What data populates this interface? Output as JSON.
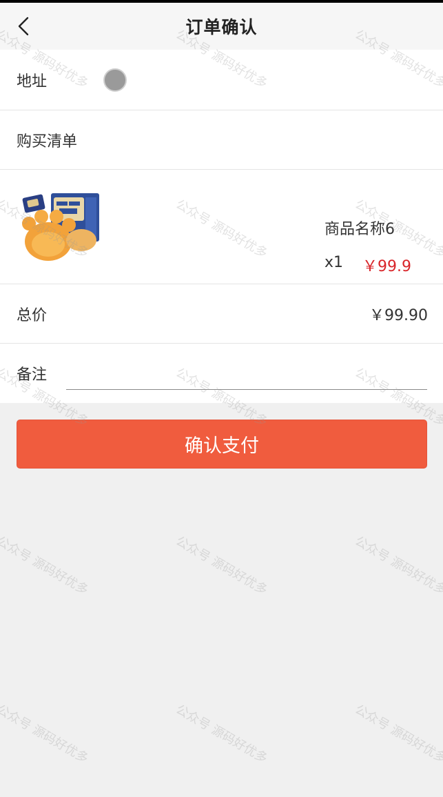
{
  "navbar": {
    "title": "订单确认",
    "back_icon": "chevron-left-icon"
  },
  "address": {
    "label": "地址"
  },
  "purchase_list": {
    "label": "购买清单"
  },
  "product": {
    "name": "商品名称6",
    "quantity": "x1",
    "price": "￥99.9",
    "image_icon": "product-image"
  },
  "total": {
    "label": "总价",
    "value": "￥99.90"
  },
  "remark": {
    "label": "备注",
    "value": ""
  },
  "pay_button": {
    "label": "确认支付"
  },
  "watermark": {
    "text": "公众号 源码好优多"
  },
  "colors": {
    "accent": "#f05c3e",
    "price": "#d9252a",
    "background": "#f0f0f0"
  }
}
